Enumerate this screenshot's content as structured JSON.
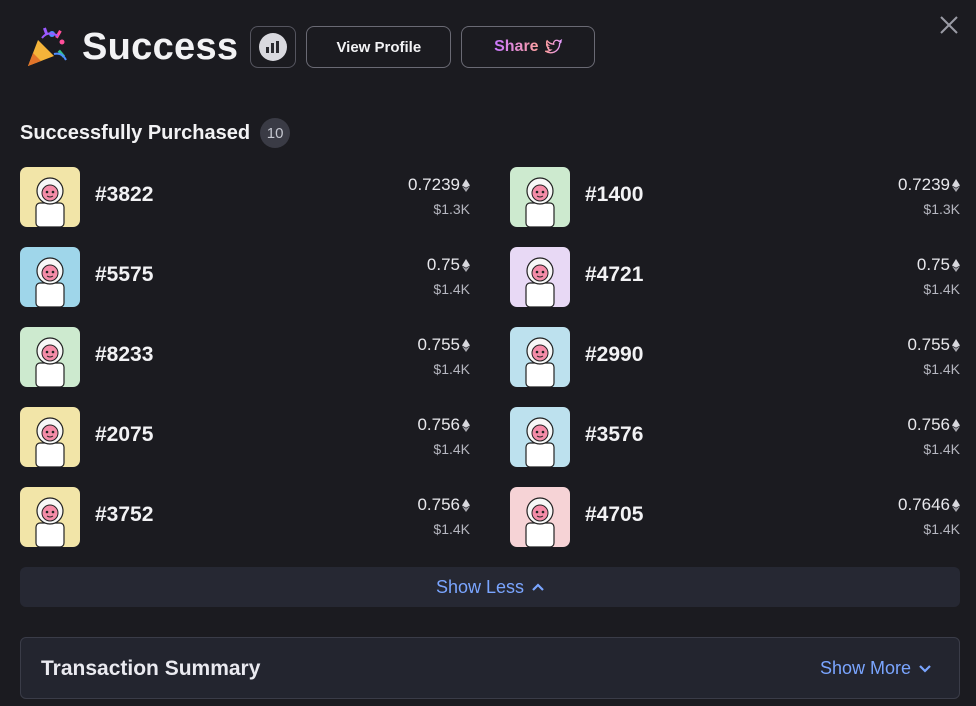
{
  "header": {
    "title": "Success",
    "view_profile_label": "View Profile",
    "share_label": "Share"
  },
  "purchased": {
    "title": "Successfully Purchased",
    "count": "10",
    "items": [
      {
        "name": "#3822",
        "price": "0.7239",
        "usd": "$1.3K",
        "bg": "#f2e5a8"
      },
      {
        "name": "#1400",
        "price": "0.7239",
        "usd": "$1.3K",
        "bg": "#cdeacf"
      },
      {
        "name": "#5575",
        "price": "0.75",
        "usd": "$1.4K",
        "bg": "#9fd6ea"
      },
      {
        "name": "#4721",
        "price": "0.75",
        "usd": "$1.4K",
        "bg": "#e8d9f5"
      },
      {
        "name": "#8233",
        "price": "0.755",
        "usd": "$1.4K",
        "bg": "#cdeacf"
      },
      {
        "name": "#2990",
        "price": "0.755",
        "usd": "$1.4K",
        "bg": "#bde1ee"
      },
      {
        "name": "#2075",
        "price": "0.756",
        "usd": "$1.4K",
        "bg": "#f2e5a8"
      },
      {
        "name": "#3576",
        "price": "0.756",
        "usd": "$1.4K",
        "bg": "#bde1ee"
      },
      {
        "name": "#3752",
        "price": "0.756",
        "usd": "$1.4K",
        "bg": "#f2e5a8"
      },
      {
        "name": "#4705",
        "price": "0.7646",
        "usd": "$1.4K",
        "bg": "#f6d3d6"
      }
    ]
  },
  "show_less_label": "Show Less",
  "summary": {
    "title": "Transaction Summary",
    "show_more_label": "Show More"
  },
  "colors": {
    "background": "#1b1b20",
    "accent_link": "#7aa5ff",
    "share_gradient_start": "#c977ff",
    "share_gradient_end": "#ffa2a0"
  }
}
